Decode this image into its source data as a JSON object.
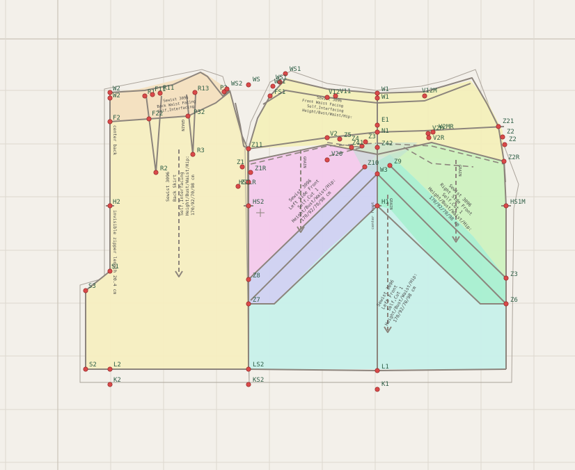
{
  "colors": {
    "background": "#f3f0ea",
    "back_skirt": "#f6efbf",
    "waistband_back": "#f3dcc0",
    "front_panel_yellow": "#f4efb8",
    "pink_panel": "#f3c9ec",
    "lavender_panel": "#cfd1f2",
    "cyan_panel": "#c7f0ea",
    "mint_panel": "#a9efd1",
    "light_green_panel": "#cdf1c0",
    "point": "#d94a4a"
  },
  "pieces": {
    "back_skirt": {
      "name": "Back Skirt",
      "lines": [
        "Sewist 3096",
        "Back Skirt",
        "Self,Interfacing",
        "Height/Bust/Waist/Hip:",
        "170/92/70/98 cm"
      ]
    },
    "back_waistband": {
      "lines": [
        "Sewist 3096",
        "Back Waist Facing",
        "Self,Interfacing",
        "Height/Bust/Waist/Hip:",
        "170/92/70/98 cm"
      ]
    },
    "left_side_front": {
      "lines": [
        "Sewist 3096",
        "Left Side Front",
        "Self,Cut 1",
        "Height/Bust/Waist/Hip:",
        "170/92/70/98 cm"
      ]
    },
    "left_front": {
      "lines": [
        "Sewist 3096",
        "Left Front",
        "Self,Cut 1",
        "Height/Bust/Waist/Hip:",
        "170/92/70/98 cm"
      ]
    },
    "right_side_front": {
      "lines": [
        "Sewist 3096",
        "Right Side Front",
        "Self,Cut 1",
        "Height/Bust/Waist/Hip:",
        "170/92/70/98 cm"
      ]
    },
    "front_waist": {
      "lines": [
        "Sewist 3096",
        "Front Waist Facing",
        "Self,Interfacing",
        "Height/Bust/Waist/Hip:",
        "170/92/70/98 cm"
      ]
    },
    "grain_label": "GRAIN",
    "center_back": "center back",
    "zipper_note": "invisible zipper length 20.4 cm",
    "center_front": "center front"
  },
  "points": [
    {
      "id": "W2",
      "label": "W2"
    },
    {
      "id": "W2b",
      "label": "W2"
    },
    {
      "id": "F2",
      "label": "F2"
    },
    {
      "id": "H2",
      "label": "H2"
    },
    {
      "id": "S1",
      "label": "S1"
    },
    {
      "id": "S3",
      "label": "S3"
    },
    {
      "id": "S2",
      "label": "S2"
    },
    {
      "id": "L2",
      "label": "L2"
    },
    {
      "id": "K2",
      "label": "K2"
    },
    {
      "id": "R1",
      "label": "R1"
    },
    {
      "id": "F11",
      "label": "F11"
    },
    {
      "id": "R11",
      "label": "R11"
    },
    {
      "id": "R13",
      "label": "R13"
    },
    {
      "id": "F22",
      "label": "F22"
    },
    {
      "id": "P32",
      "label": "P32"
    },
    {
      "id": "R2",
      "label": "R2"
    },
    {
      "id": "R3",
      "label": "R3"
    },
    {
      "id": "P2",
      "label": "P2"
    },
    {
      "id": "WS2",
      "label": "WS2"
    },
    {
      "id": "WS",
      "label": "WS"
    },
    {
      "id": "WS1",
      "label": "WS1"
    },
    {
      "id": "WS1b",
      "label": "WS1"
    },
    {
      "id": "WS1c",
      "label": "WS1"
    },
    {
      "id": "FS1",
      "label": "FS1"
    },
    {
      "id": "V12",
      "label": "V12"
    },
    {
      "id": "V11",
      "label": "V11"
    },
    {
      "id": "W1",
      "label": "W1"
    },
    {
      "id": "W1b",
      "label": "W1"
    },
    {
      "id": "V12M",
      "label": "V12M"
    },
    {
      "id": "E1",
      "label": "E1"
    },
    {
      "id": "N1",
      "label": "N1"
    },
    {
      "id": "V2",
      "label": "V2"
    },
    {
      "id": "Z5",
      "label": "Z5"
    },
    {
      "id": "Z3",
      "label": "Z3"
    },
    {
      "id": "Z4",
      "label": "Z4"
    },
    {
      "id": "Z41",
      "label": "Z41"
    },
    {
      "id": "Z42",
      "label": "Z42"
    },
    {
      "id": "V20",
      "label": "V20"
    },
    {
      "id": "V2M",
      "label": "V2M"
    },
    {
      "id": "V2R",
      "label": "V2R"
    },
    {
      "id": "V2MR",
      "label": "V2MR"
    },
    {
      "id": "Z21",
      "label": "Z21"
    },
    {
      "id": "Z2a",
      "label": "Z2"
    },
    {
      "id": "Z2b",
      "label": "Z2"
    },
    {
      "id": "Z2R",
      "label": "Z2R"
    },
    {
      "id": "Z11",
      "label": "Z11"
    },
    {
      "id": "Z1R",
      "label": "Z1R"
    },
    {
      "id": "Z1",
      "label": "Z1"
    },
    {
      "id": "Z1L",
      "label": "Z1LR"
    },
    {
      "id": "HS1",
      "label": "HS1"
    },
    {
      "id": "HS2",
      "label": "HS2"
    },
    {
      "id": "Z10",
      "label": "Z10"
    },
    {
      "id": "Z9",
      "label": "Z9"
    },
    {
      "id": "W3",
      "label": "W3"
    },
    {
      "id": "H1",
      "label": "H1"
    },
    {
      "id": "HS1M",
      "label": "HS1M"
    },
    {
      "id": "Z8",
      "label": "Z8"
    },
    {
      "id": "Z7",
      "label": "Z7"
    },
    {
      "id": "Z6",
      "label": "Z6"
    },
    {
      "id": "Z3b",
      "label": "Z3"
    },
    {
      "id": "LS2",
      "label": "LS2"
    },
    {
      "id": "KS2",
      "label": "KS2"
    },
    {
      "id": "L1",
      "label": "L1"
    },
    {
      "id": "K1",
      "label": "K1"
    }
  ]
}
